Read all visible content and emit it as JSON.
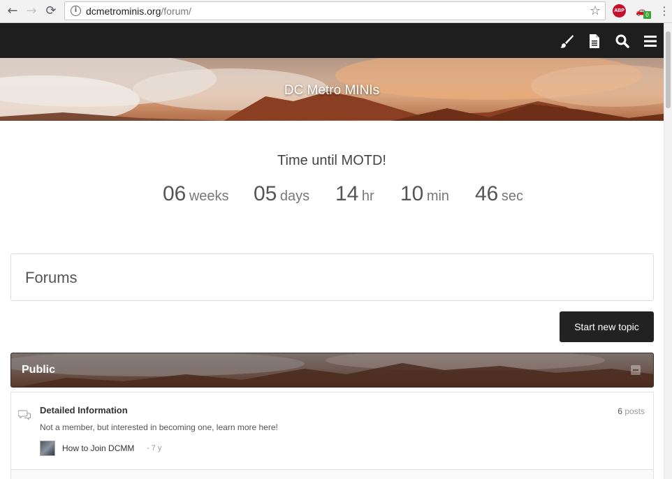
{
  "browser": {
    "url_host": "dcmetrominis.org",
    "url_path": "/forum/",
    "abp_label": "ABP",
    "ext_badge": "0"
  },
  "site": {
    "title": "DC Metro MINIs"
  },
  "motd": {
    "title": "Time until MOTD!",
    "countdown": [
      {
        "value": "06",
        "unit": "weeks"
      },
      {
        "value": "05",
        "unit": "days"
      },
      {
        "value": "14",
        "unit": "hr"
      },
      {
        "value": "10",
        "unit": "min"
      },
      {
        "value": "46",
        "unit": "sec"
      }
    ]
  },
  "forums": {
    "heading": "Forums",
    "new_topic_label": "Start new topic",
    "categories": [
      {
        "name": "Public",
        "forums": [
          {
            "name": "Detailed Information",
            "description": "Not a member, but interested in becoming one, learn more here!",
            "post_count": "6",
            "post_label": "posts",
            "latest_title": "How to Join DCMM",
            "latest_age": "- 7 y"
          }
        ]
      }
    ]
  },
  "icons": {
    "topbar": [
      "brush-icon",
      "document-icon",
      "search-icon",
      "menu-icon"
    ],
    "accent": "#1e1e1e"
  }
}
